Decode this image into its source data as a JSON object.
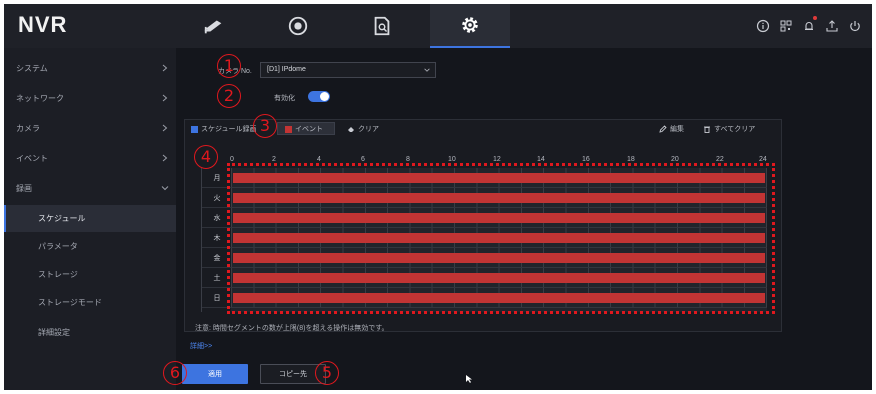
{
  "app": {
    "logo": "NVR"
  },
  "topbar": {
    "tabs": [
      {
        "icon": "camera-icon"
      },
      {
        "icon": "playback-icon"
      },
      {
        "icon": "file-search-icon"
      },
      {
        "icon": "gear-icon",
        "active": true
      }
    ],
    "right_icons": [
      "info-icon",
      "qr-code-icon",
      "bell-icon",
      "upload-icon",
      "power-icon"
    ]
  },
  "sidebar": {
    "items": [
      {
        "label": "システム",
        "expandable": true
      },
      {
        "label": "ネットワーク",
        "expandable": true
      },
      {
        "label": "カメラ",
        "expandable": true
      },
      {
        "label": "イベント",
        "expandable": true
      },
      {
        "label": "録画",
        "expanded": true
      },
      {
        "label": "スケジュール",
        "sub": true,
        "active": true
      },
      {
        "label": "パラメータ",
        "sub": true
      },
      {
        "label": "ストレージ",
        "sub": true
      },
      {
        "label": "ストレージモード",
        "sub": true
      },
      {
        "label": "詳細設定",
        "sub": true
      }
    ]
  },
  "form": {
    "camera_label": "カメラ No.",
    "camera_value": "[D1] IPdome",
    "enable_label": "有効化",
    "enable_on": true
  },
  "schedule": {
    "legend_schedule": "スケジュール録画",
    "legend_event": "イベント",
    "clear_label": "クリア",
    "edit_label": "編集",
    "clear_all_label": "すべてクリア",
    "schedule_color": "#3d74e0",
    "event_color": "#c23434",
    "hours": [
      "0",
      "2",
      "4",
      "6",
      "8",
      "10",
      "12",
      "14",
      "16",
      "18",
      "20",
      "22",
      "24"
    ],
    "days": [
      "月",
      "火",
      "水",
      "木",
      "金",
      "土",
      "日"
    ],
    "note": "注意: 時間セグメントの数が上限(8)を超える操作は無効です。"
  },
  "advanced_link": "詳細>>",
  "buttons": {
    "apply": "適用",
    "copy": "コピー先"
  },
  "annotations": [
    "1",
    "2",
    "3",
    "4",
    "5",
    "6"
  ]
}
